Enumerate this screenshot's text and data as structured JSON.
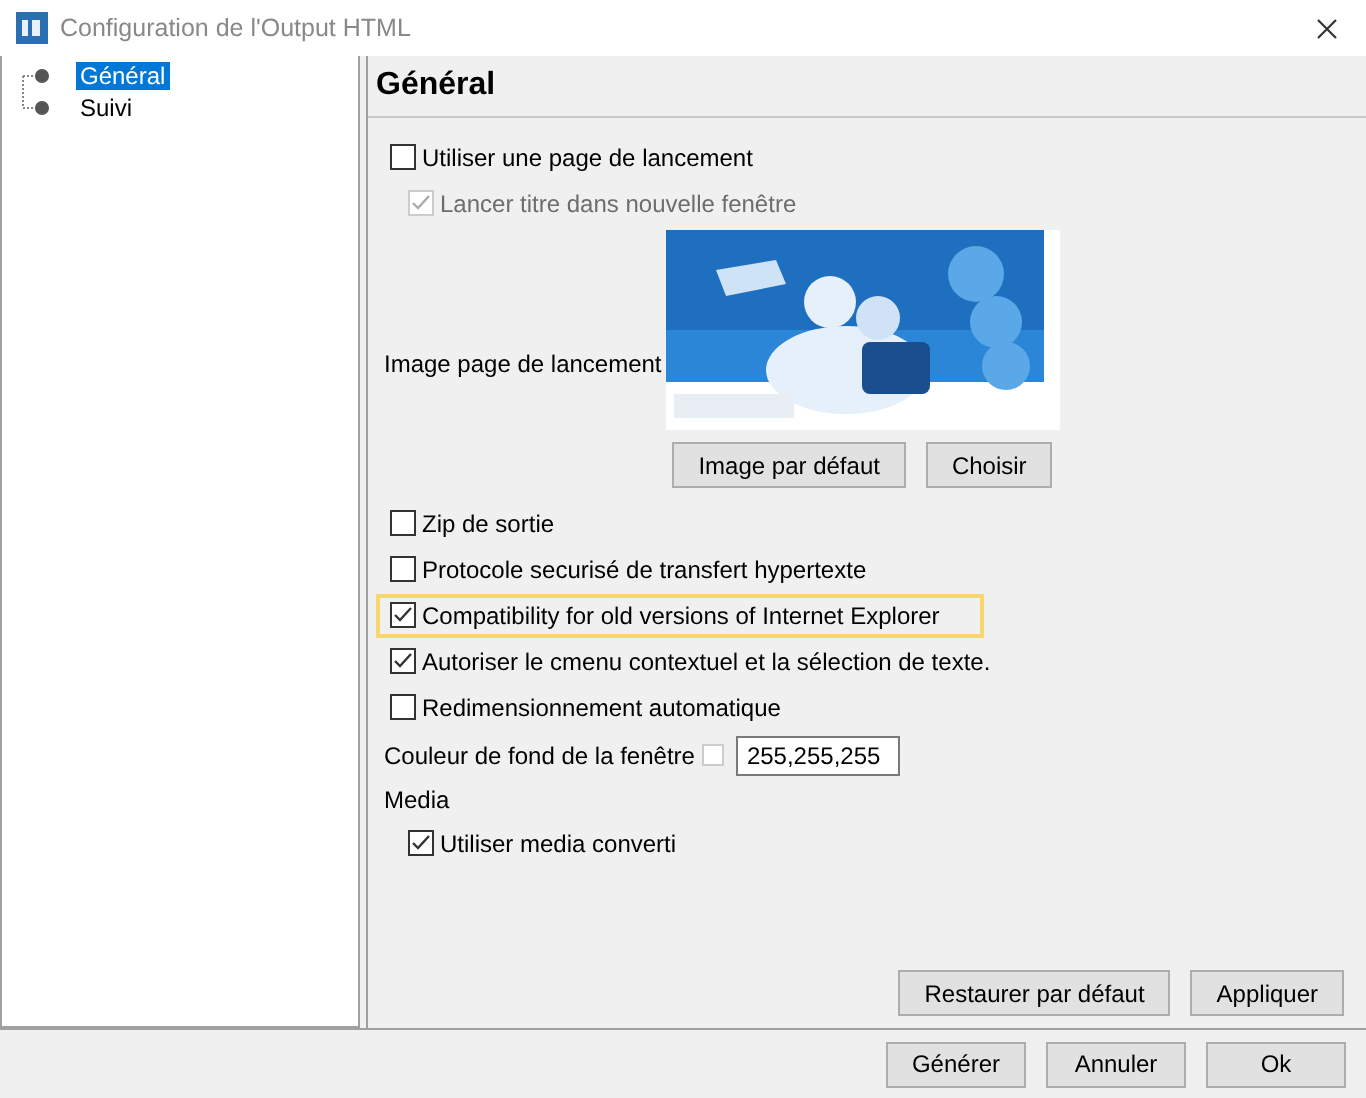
{
  "window": {
    "title": "Configuration de l'Output HTML"
  },
  "tree": [
    {
      "label": "Général",
      "selected": true
    },
    {
      "label": "Suivi",
      "selected": false
    }
  ],
  "panel": {
    "heading": "Général"
  },
  "options": [
    {
      "kind": "checkbox",
      "label": "Utiliser une page de lancement",
      "checked": false,
      "disabled": false,
      "indented": false,
      "highlighted": false
    },
    {
      "kind": "checkbox",
      "label": "Lancer titre dans nouvelle fenêtre",
      "checked": true,
      "disabled": true,
      "indented": true,
      "highlighted": false
    },
    {
      "label": "Image page de lancement",
      "image": {
        "kind": "picture"
      },
      "buttons": [
        "Image par défaut",
        "Choisir"
      ]
    },
    {
      "kind": "checkbox",
      "label": "Zip de sortie",
      "checked": false,
      "disabled": false,
      "indented": false,
      "highlighted": false
    },
    {
      "kind": "checkbox",
      "label": "Protocole securisé de transfert hypertexte",
      "checked": false,
      "disabled": false,
      "indented": false,
      "highlighted": false
    },
    {
      "kind": "checkbox",
      "label": "Compatibility for old versions of Internet Explorer",
      "checked": true,
      "disabled": false,
      "indented": false,
      "highlighted": true
    },
    {
      "kind": "checkbox",
      "label": "Autoriser le cmenu contextuel et la sélection de texte.",
      "checked": true,
      "disabled": false,
      "indented": false,
      "highlighted": false
    },
    {
      "kind": "checkbox",
      "label": "Redimensionnement automatique",
      "checked": false,
      "disabled": false,
      "indented": false,
      "highlighted": false
    },
    {
      "kind": "color",
      "label": "Couleur de fond de la fenêtre",
      "color": "#ffffff",
      "value": "255,255,255"
    },
    {
      "kind": "section",
      "label": "Media"
    },
    {
      "kind": "checkbox",
      "label": "Utiliser media converti",
      "checked": true,
      "disabled": false,
      "indented": true,
      "highlighted": false
    }
  ],
  "panel_buttons": [
    "Restaurer par défaut",
    "Appliquer"
  ],
  "footer_buttons": [
    "Générer",
    "Annuler",
    "Ok"
  ]
}
